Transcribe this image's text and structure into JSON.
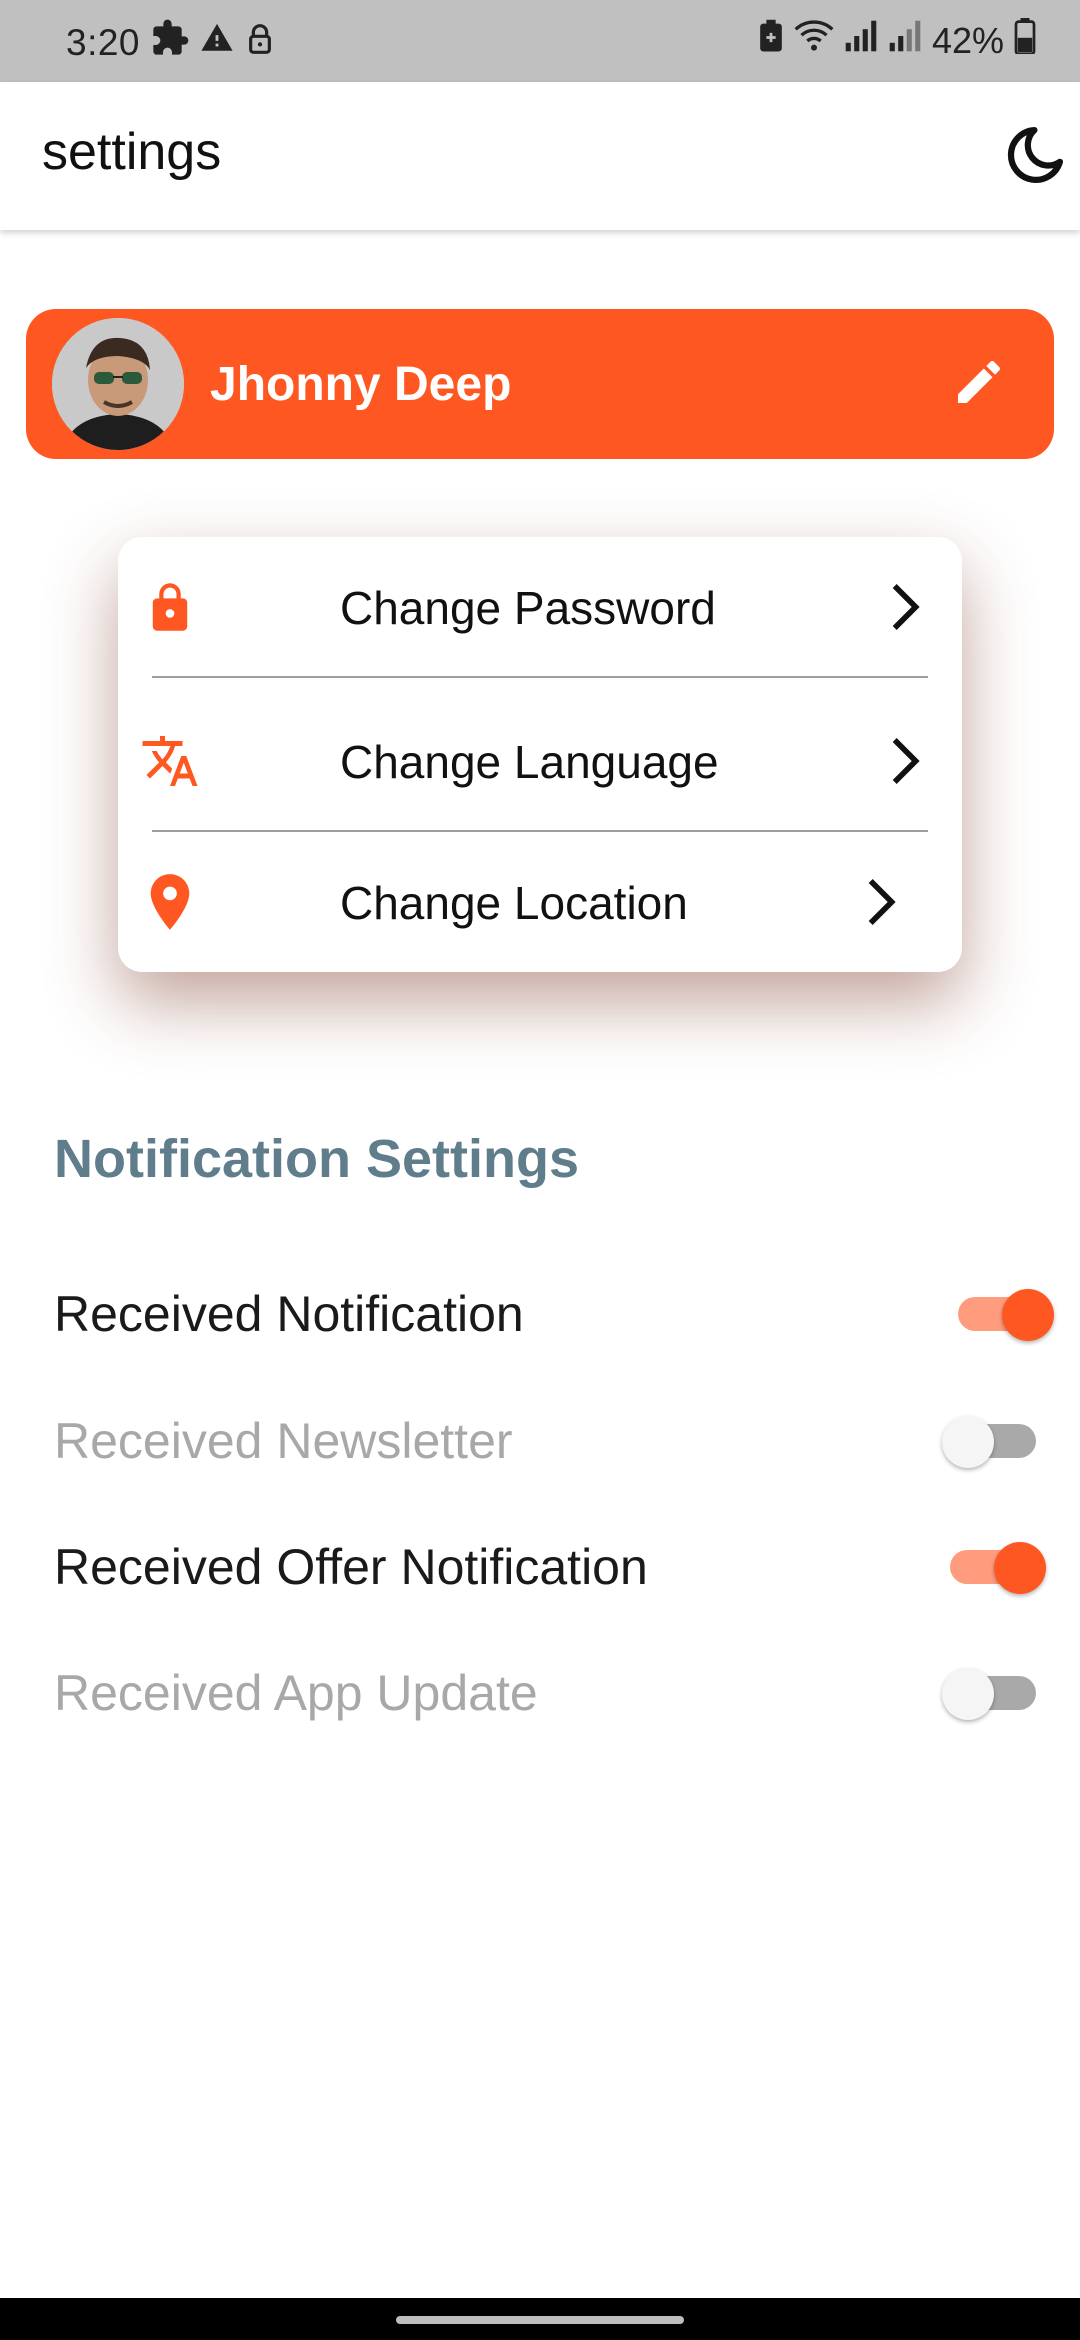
{
  "status_bar": {
    "time": "3:20",
    "battery": "42%",
    "icons": [
      "puzzle-icon",
      "warning-icon",
      "lock-icon",
      "battery-saver-icon",
      "wifi-icon",
      "signal-icon",
      "signal-icon",
      "battery-icon"
    ]
  },
  "app_bar": {
    "title": "settings",
    "theme_icon": "moon-icon"
  },
  "profile": {
    "name": "Jhonny Deep",
    "edit_icon": "pencil-icon"
  },
  "menu": {
    "items": [
      {
        "label": "Change Password",
        "icon": "lock-icon"
      },
      {
        "label": "Change Language",
        "icon": "translate-icon"
      },
      {
        "label": "Change Location",
        "icon": "location-pin-icon"
      }
    ]
  },
  "notifications": {
    "title": "Notification Settings",
    "items": [
      {
        "label": "Received Notification",
        "enabled": true
      },
      {
        "label": "Received Newsletter",
        "enabled": false
      },
      {
        "label": "Received Offer Notification",
        "enabled": true
      },
      {
        "label": "Received App Update",
        "enabled": false
      }
    ]
  },
  "colors": {
    "accent": "#ff5722",
    "accent_light": "#ff9c7e",
    "section_title": "#607d8b",
    "status_bar": "#c0c0c0"
  }
}
